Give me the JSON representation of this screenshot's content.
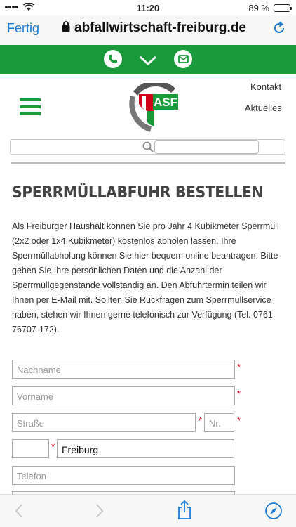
{
  "status": {
    "time": "11:20",
    "battery": "89 %",
    "battery_level": 0.89
  },
  "browser": {
    "done_label": "Fertig",
    "url": "abfallwirtschaft-freiburg.de"
  },
  "header": {
    "logo_text": "ASF",
    "links": [
      "Kontakt",
      "Aktuelles"
    ]
  },
  "page": {
    "title": "SPERRMÜLLABFUHR BESTELLEN",
    "intro": "Als Freiburger Haushalt können Sie pro Jahr 4 Kubikmeter Sperrmüll (2x2 oder 1x4 Kubikmeter) kostenlos abholen lassen. Ihre Sperrmüllabholung können Sie hier bequem online beantragen. Bitte geben Sie Ihre persönlichen Daten und die Anzahl der Sperrmüllgegenstände vollständig an. Den Abfuhrtermin teilen wir Ihnen per E-Mail mit. Sollten Sie Rückfragen zum Sperrmüllservice haben, stehen wir Ihnen gerne telefonisch zur Verfügung (Tel. 0761 76707-172)."
  },
  "form": {
    "nachname": {
      "placeholder": "Nachname",
      "value": ""
    },
    "vorname": {
      "placeholder": "Vorname",
      "value": ""
    },
    "strasse": {
      "placeholder": "Straße",
      "value": ""
    },
    "nr": {
      "placeholder": "Nr.",
      "value": ""
    },
    "plz": {
      "placeholder": "",
      "value": ""
    },
    "ort": {
      "placeholder": "",
      "value": "Freiburg"
    },
    "telefon": {
      "placeholder": "Telefon",
      "value": ""
    },
    "required_mark": "*"
  },
  "colors": {
    "accent": "#1a9a3a",
    "link": "#1e7bd4",
    "required": "#d0021b"
  }
}
